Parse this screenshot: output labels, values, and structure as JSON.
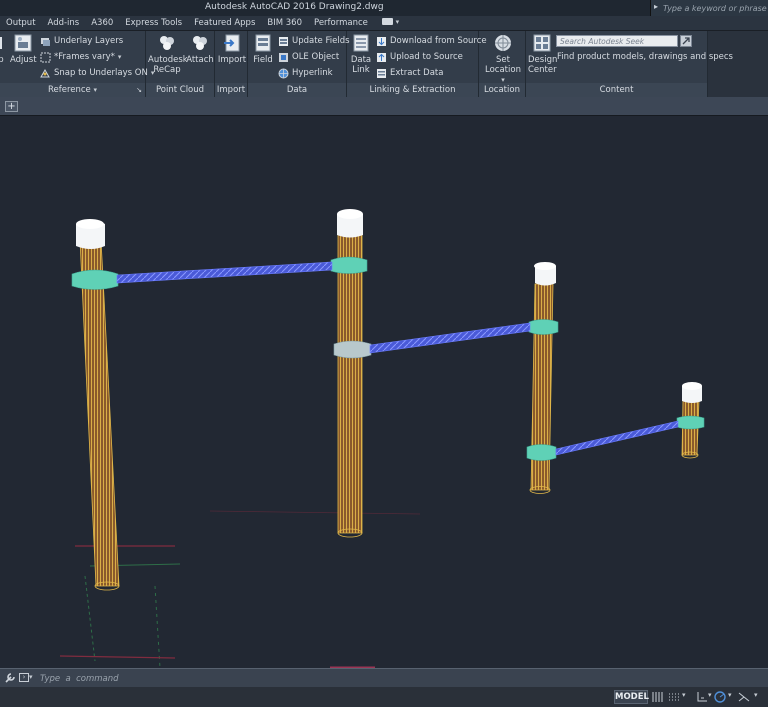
{
  "titlebar": {
    "title": "Autodesk AutoCAD 2016    Drawing2.dwg",
    "search_placeholder": "Type a keyword or phrase"
  },
  "tabs": [
    {
      "label": "Output"
    },
    {
      "label": "Add-ins"
    },
    {
      "label": "A360"
    },
    {
      "label": "Express Tools"
    },
    {
      "label": "Featured Apps"
    },
    {
      "label": "BIM 360"
    },
    {
      "label": "Performance"
    }
  ],
  "ribbon": {
    "reference": {
      "footer": "Reference",
      "left_cut_label": "p",
      "adjust_label": "Adjust",
      "underlay_layers": "Underlay Layers",
      "frames_vary": "*Frames vary*",
      "snap_underlays": "Snap to Underlays ON"
    },
    "point_cloud": {
      "footer": "Point Cloud",
      "recap_label_1": "Autodesk",
      "recap_label_2": "ReCap",
      "attach_label": "Attach"
    },
    "import": {
      "footer": "Import",
      "import_label": "Import"
    },
    "data": {
      "footer": "Data",
      "field_label": "Field",
      "update_fields": "Update Fields",
      "ole_object": "OLE Object",
      "hyperlink": "Hyperlink"
    },
    "linking": {
      "footer": "Linking & Extraction",
      "data_link_1": "Data",
      "data_link_2": "Link",
      "download": "Download from Source",
      "upload": "Upload to Source",
      "extract": "Extract  Data"
    },
    "location": {
      "footer": "Location",
      "set_label_1": "Set",
      "set_label_2": "Location"
    },
    "content": {
      "footer": "Content",
      "design_1": "Design",
      "design_2": "Center",
      "seek_placeholder": "Search Autodesk Seek",
      "seek_caption": "Find product models, drawings and specs"
    }
  },
  "filetabs": {
    "plus": "+"
  },
  "cmdline": {
    "placeholder": "Type  a  command"
  },
  "statusbar": {
    "model": "MODEL"
  },
  "colors": {
    "post_wood": "#c9853a",
    "post_line": "#e3b94a",
    "cap": "#f4f6f8",
    "collar": "#5fd1b6",
    "bar": "#5a6cf0",
    "viewport_bg": "#222833"
  }
}
